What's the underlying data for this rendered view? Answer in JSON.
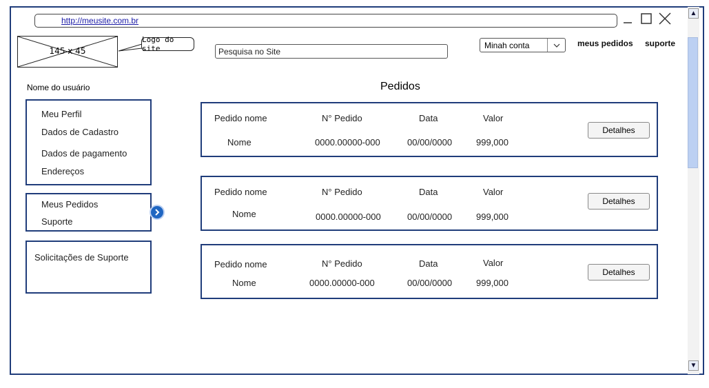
{
  "browser": {
    "url": "http://meusite.com.br",
    "minimize_icon": "minimize-icon",
    "maximize_icon": "maximize-icon",
    "close_icon": "close-icon"
  },
  "header": {
    "logo_placeholder": "145 x 45",
    "logo_callout": "Logo do site",
    "search_placeholder": "Pesquisa no Site",
    "account_select": "Minah conta",
    "nav_links": [
      "meus pedidos",
      "suporte"
    ]
  },
  "sidebar": {
    "username": "Nome do usuário",
    "group1": [
      "Meu Perfil",
      "Dados de Cadastro",
      "Dados de pagamento",
      "Endereços"
    ],
    "group2": [
      "Meus Pedidos",
      "Suporte"
    ],
    "group3": [
      "Solicitações de Suporte"
    ]
  },
  "main": {
    "title": "Pedidos",
    "orders": [
      {
        "h_name": "Pedido nome",
        "h_num": "N° Pedido",
        "h_date": "Data",
        "h_value": "Valor",
        "name": "Nome",
        "num": "0000.00000-000",
        "date": "00/00/0000",
        "value": "999,000",
        "button": "Detalhes"
      },
      {
        "h_name": "Pedido nome",
        "h_num": "N° Pedido",
        "h_date": "Data",
        "h_value": "Valor",
        "name": "Nome",
        "num": "0000.00000-000",
        "date": "00/00/0000",
        "value": "999,000",
        "button": "Detalhes"
      },
      {
        "h_name": "Pedido nome",
        "h_num": "N° Pedido",
        "h_date": "Data",
        "h_value": "Valor",
        "name": "Nome",
        "num": "0000.00000-000",
        "date": "00/00/0000",
        "value": "999,000",
        "button": "Detalhes"
      }
    ]
  },
  "colors": {
    "border": "#1f3c7a",
    "link": "#1a1aa6",
    "accent": "#1f66c2"
  }
}
